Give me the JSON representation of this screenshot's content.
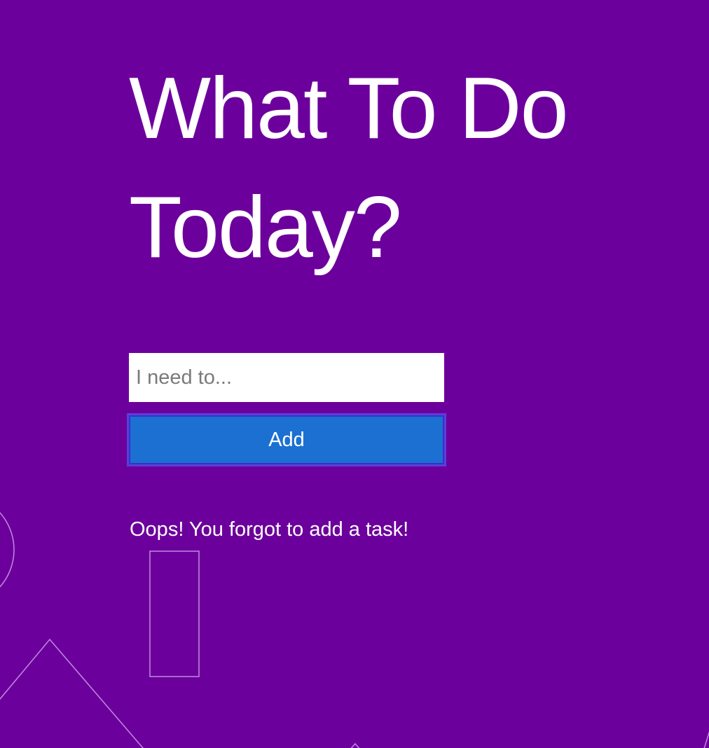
{
  "header": {
    "title_line1": "What To Do",
    "title_line2": "Today?"
  },
  "form": {
    "input_placeholder": "I need to...",
    "input_value": "",
    "add_label": "Add"
  },
  "error": {
    "message": "Oops! You forgot to add a task!"
  },
  "colors": {
    "background": "#6c009c",
    "button": "#1b70d2",
    "text": "#ffffff"
  }
}
